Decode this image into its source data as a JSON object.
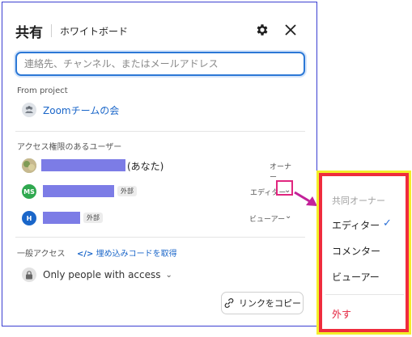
{
  "header": {
    "title": "共有",
    "subtitle": "ホワイトボード"
  },
  "search": {
    "placeholder": "連絡先、チャンネル、またはメールアドレス"
  },
  "project": {
    "section_label": "From project",
    "name": "Zoomチームの会"
  },
  "users": {
    "section_label": "アクセス権限のあるユーザー",
    "list": [
      {
        "avatar": "",
        "avatar_color": "#8aa36a",
        "suffix": "(あなた)",
        "badge": "",
        "role": "オーナー"
      },
      {
        "avatar": "MS",
        "avatar_color": "#2fa84f",
        "suffix": "",
        "badge": "外部",
        "role": "エディター"
      },
      {
        "avatar": "H",
        "avatar_color": "#1a66c9",
        "suffix": "",
        "badge": "外部",
        "role": "ビューアー"
      }
    ]
  },
  "general": {
    "label": "一般アクセス",
    "embed_link": "埋め込みコードを取得",
    "access_value": "Only people with access"
  },
  "copy_button": {
    "label": "リンクをコピー"
  },
  "role_menu": {
    "items": [
      {
        "label": "共同オーナー",
        "state": "disabled"
      },
      {
        "label": "エディター",
        "state": "selected"
      },
      {
        "label": "コメンター",
        "state": "normal"
      },
      {
        "label": "ビューアー",
        "state": "normal"
      },
      {
        "label": "外す",
        "state": "danger"
      }
    ],
    "check_mark": "✓"
  },
  "colors": {
    "accent": "#1a66c9",
    "highlight_pink": "#e0267f",
    "menu_border": "#ef2c3d",
    "menu_outline": "#f3ee2a",
    "redaction": "#7c7ce6"
  }
}
